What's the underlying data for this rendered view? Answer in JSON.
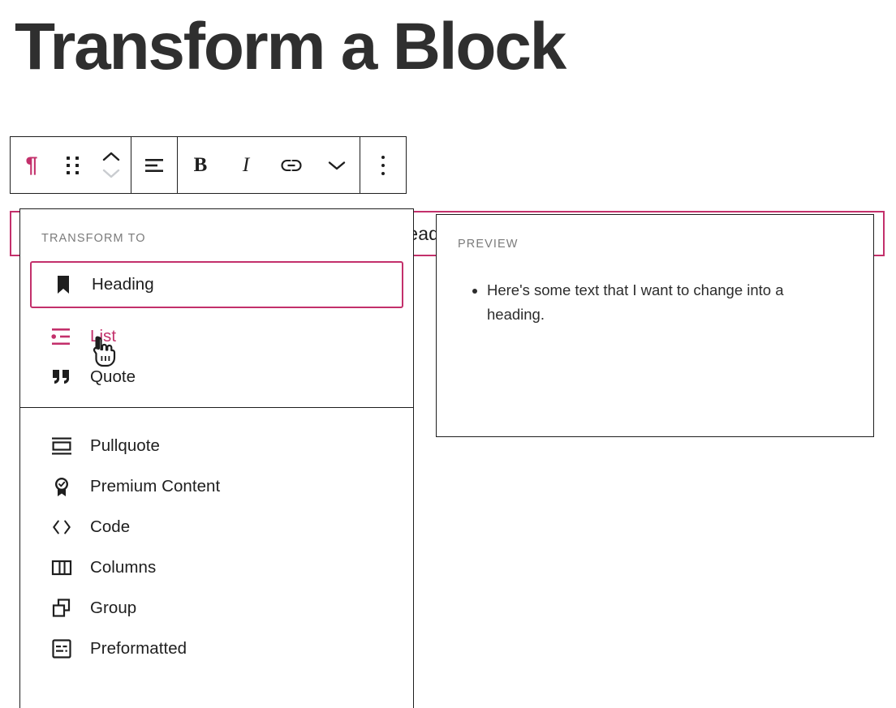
{
  "page": {
    "title": "Transform a Block",
    "title_color": "#2f2f2f",
    "accent_color": "#c3306b",
    "border_color": "#1e1e1e"
  },
  "toolbar": {
    "buttons": [
      {
        "name": "block-type-paragraph",
        "icon": "paragraph-pilcrow-icon",
        "glyph": "¶",
        "label": "Paragraph"
      },
      {
        "name": "drag-handle",
        "icon": "drag-handle-icon",
        "label": "Drag"
      },
      {
        "name": "move-updown",
        "icon": "chevron-up-down-icon",
        "label": "Move up or down"
      },
      {
        "name": "align-text",
        "icon": "align-text-icon",
        "label": "Align text"
      },
      {
        "name": "bold",
        "icon": "bold-icon",
        "glyph": "B",
        "label": "Bold"
      },
      {
        "name": "italic",
        "icon": "italic-icon",
        "glyph": "I",
        "label": "Italic"
      },
      {
        "name": "link",
        "icon": "link-icon",
        "label": "Link"
      },
      {
        "name": "more-rich-text",
        "icon": "chevron-down-icon",
        "label": "More rich text controls"
      },
      {
        "name": "more-options",
        "icon": "vertical-dots-icon",
        "label": "Options"
      }
    ]
  },
  "block": {
    "text": "Here's some text that I want to change into a heading."
  },
  "transform_menu": {
    "label": "TRANSFORM TO",
    "groups": [
      {
        "items": [
          {
            "label": "Heading",
            "icon": "bookmark-icon",
            "state": "selected"
          },
          {
            "label": "List",
            "icon": "list-icon",
            "state": "hovered"
          },
          {
            "label": "Quote",
            "icon": "quote-marks-icon",
            "state": "normal"
          }
        ]
      },
      {
        "items": [
          {
            "label": "Pullquote",
            "icon": "pullquote-icon",
            "state": "normal"
          },
          {
            "label": "Premium Content",
            "icon": "award-badge-icon",
            "state": "normal"
          },
          {
            "label": "Code",
            "icon": "angle-brackets-icon",
            "state": "normal"
          },
          {
            "label": "Columns",
            "icon": "columns-icon",
            "state": "normal"
          },
          {
            "label": "Group",
            "icon": "group-squares-icon",
            "state": "normal"
          },
          {
            "label": "Preformatted",
            "icon": "preformatted-icon",
            "state": "normal"
          }
        ]
      }
    ]
  },
  "preview": {
    "label": "PREVIEW",
    "items": [
      "Here's some text that I want to change into a heading."
    ]
  },
  "cursor": {
    "icon": "pointing-hand-cursor"
  }
}
